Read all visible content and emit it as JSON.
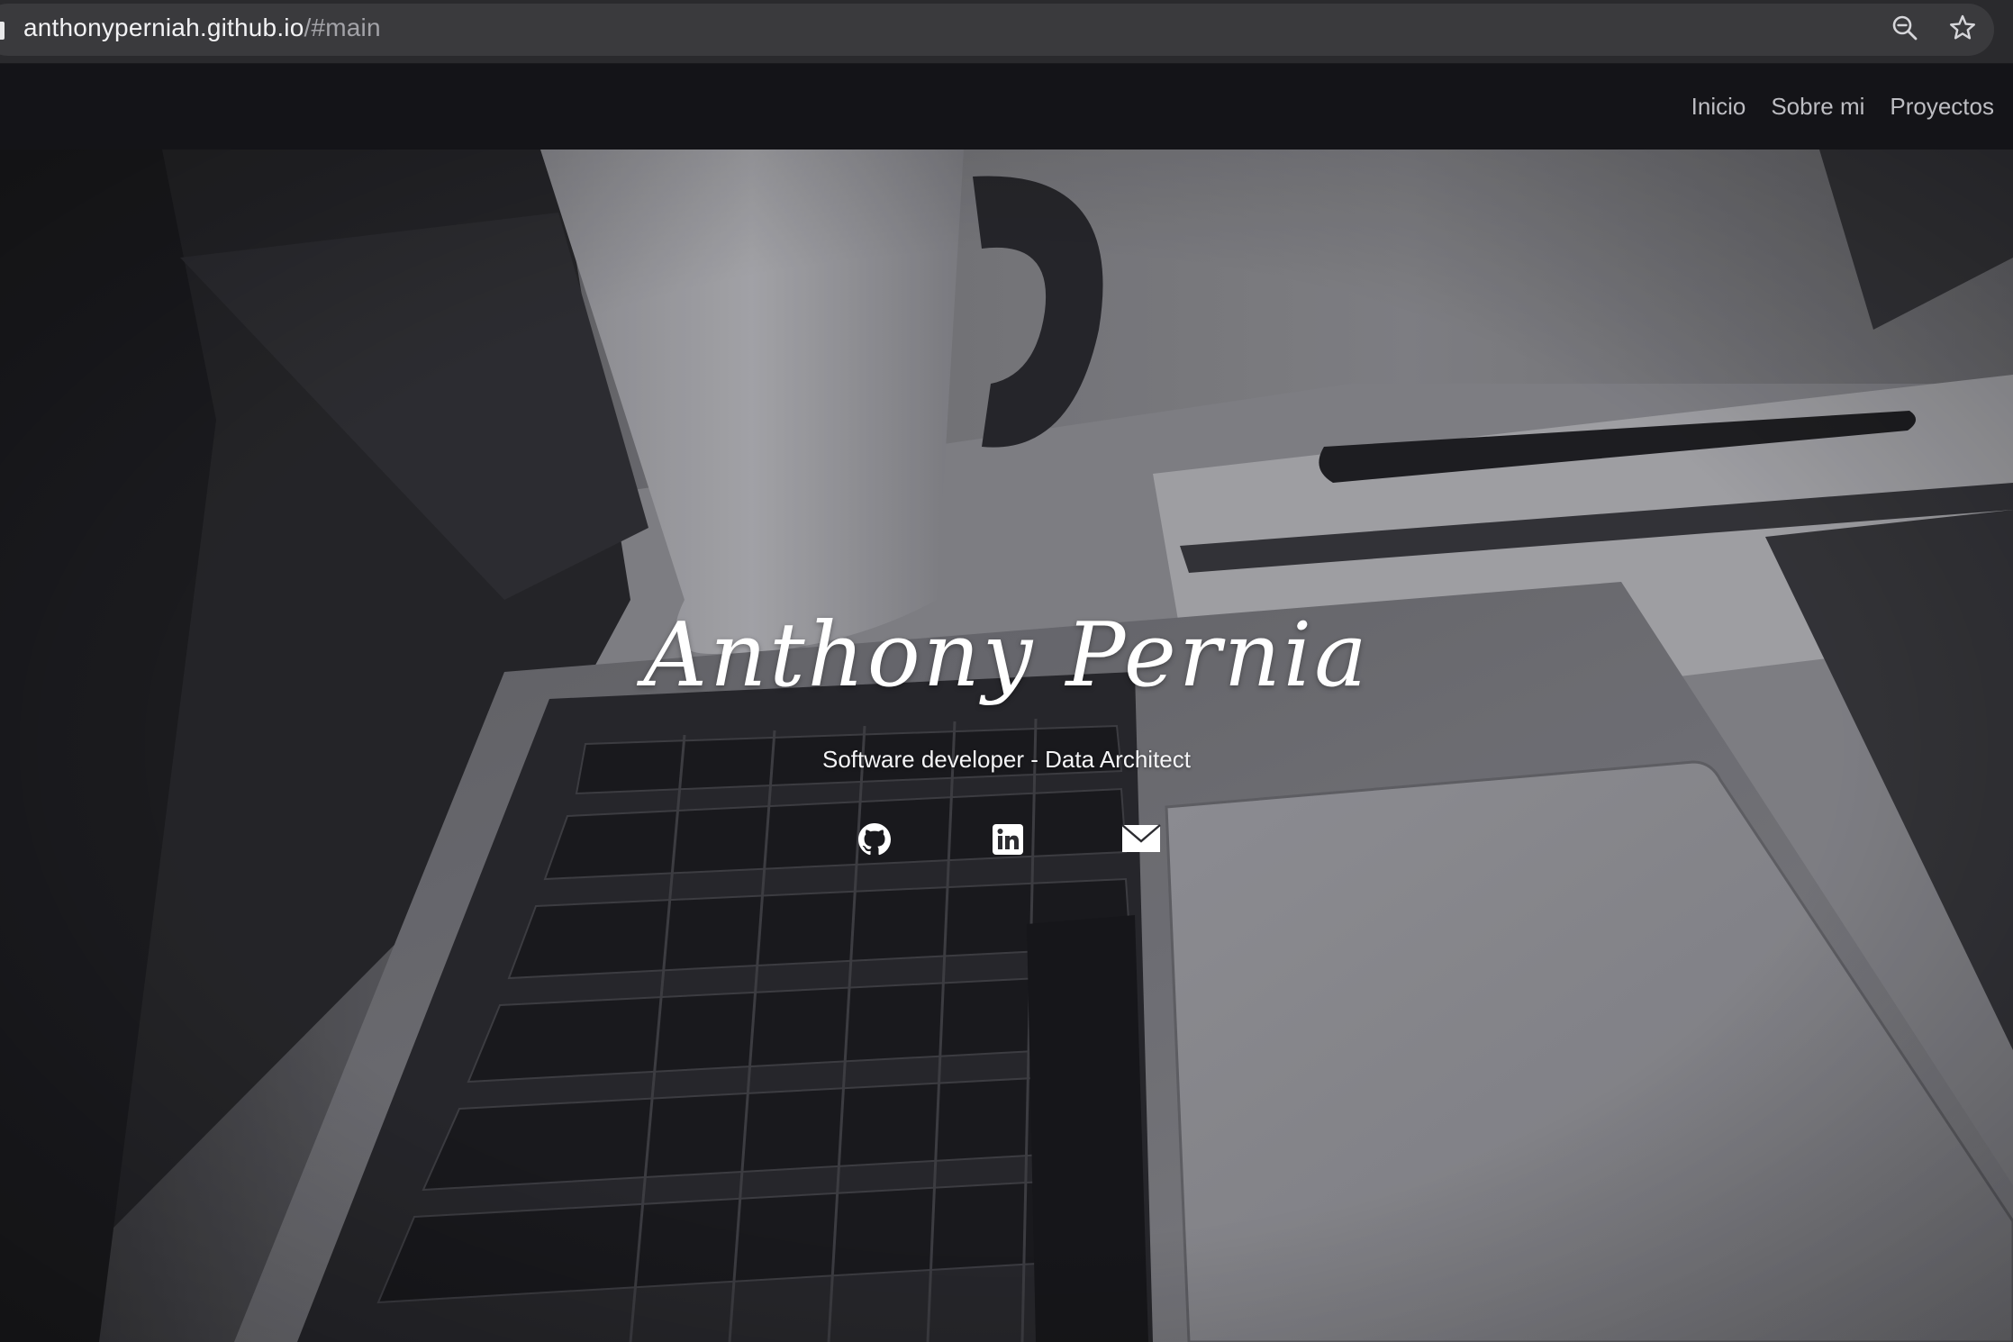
{
  "browser": {
    "url_host": "anthonyperniah.github.io",
    "url_path": "/#main",
    "icons": [
      "zoom-icon",
      "bookmark-star-icon"
    ]
  },
  "nav": {
    "items": [
      {
        "label": "Inicio"
      },
      {
        "label": "Sobre mi"
      },
      {
        "label": "Proyectos"
      }
    ]
  },
  "hero": {
    "name": "Anthony Pernia",
    "subtitle": "Software developer - Data Architect",
    "social_icons": [
      "github-icon",
      "linkedin-icon",
      "email-icon"
    ]
  },
  "colors": {
    "chrome_bar": "#2a2a2d",
    "omnibox": "#3a3a3d",
    "navbar": "#141418",
    "nav_text": "#bdbdc2",
    "hero_text": "#ffffff"
  }
}
